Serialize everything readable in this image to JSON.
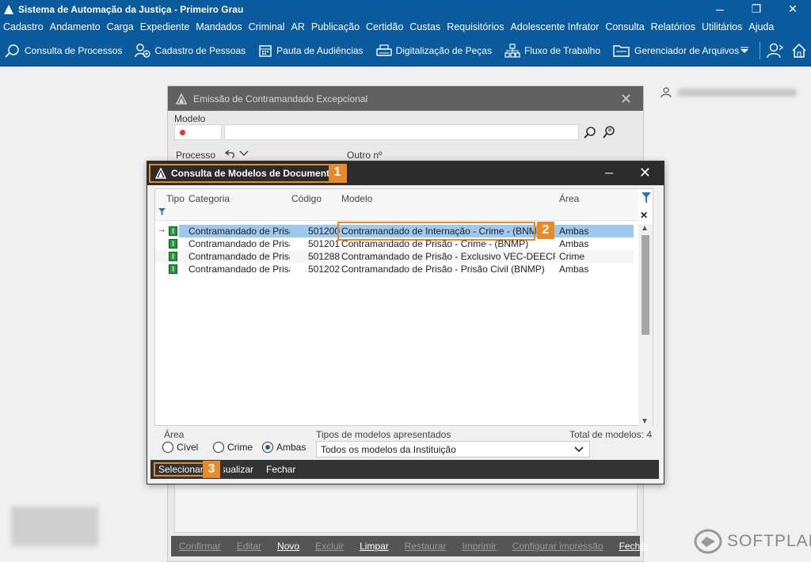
{
  "app": {
    "title": "Sistema de Automação da Justiça - Primeiro Grau"
  },
  "menu": [
    "Cadastro",
    "Andamento",
    "Carga",
    "Expediente",
    "Mandados",
    "Criminal",
    "AR",
    "Publicação",
    "Certidão",
    "Custas",
    "Requisitórios",
    "Adolescente Infrator",
    "Consulta",
    "Relatórios",
    "Utilitários",
    "Ajuda"
  ],
  "toolbar": {
    "items": [
      {
        "label": "Consulta de Processos",
        "icon": "search-folder-icon"
      },
      {
        "label": "Cadastro de Pessoas",
        "icon": "add-person-icon"
      },
      {
        "label": "Pauta de Audiências",
        "icon": "calendar-icon"
      },
      {
        "label": "Digitalização de Peças",
        "icon": "scanner-icon"
      },
      {
        "label": "Fluxo de Trabalho",
        "icon": "workflow-icon"
      },
      {
        "label": "Gerenciador de Arquivos",
        "icon": "file-manager-icon"
      }
    ]
  },
  "back_window": {
    "title": "Emissão de Contramandado Excepcional",
    "modelo_label": "Modelo",
    "processo_label": "Processo",
    "outro_label": "Outro nº",
    "buttons": {
      "confirmar": "Confirmar",
      "editar": "Editar",
      "novo": "Novo",
      "excluir": "Excluir",
      "limpar": "Limpar",
      "restaurar": "Restaurar",
      "imprimir": "Imprimir",
      "configurar": "Configurar impressão",
      "fechar": "Fechar"
    }
  },
  "dialog": {
    "title": "Consulta de Modelos de Documentos",
    "columns": {
      "tipo": "Tipo",
      "categoria": "Categoria",
      "codigo": "Código",
      "modelo": "Modelo",
      "area": "Área"
    },
    "rows": [
      {
        "categoria": "Contramandado de Prisão",
        "codigo": "501200",
        "modelo": "Contramandado de Internação - Crime - (BNMP)",
        "area": "Ambas"
      },
      {
        "categoria": "Contramandado de Prisão",
        "codigo": "501201",
        "modelo": "Contramandado de Prisão - Crime - (BNMP)",
        "area": "Ambas"
      },
      {
        "categoria": "Contramandado de Prisão",
        "codigo": "501288",
        "modelo": "Contramandado de Prisão - Exclusivo VEC-DEECRIM - (BNMP)",
        "area": "Crime"
      },
      {
        "categoria": "Contramandado de Prisão",
        "codigo": "501202",
        "modelo": "Contramandado de Prisão - Prisão Civil (BNMP)",
        "area": "Ambas"
      }
    ],
    "area_label": "Área",
    "radios": {
      "civel": "Cível",
      "crime": "Crime",
      "ambas": "Ambas"
    },
    "tipos_label": "Tipos de modelos apresentados",
    "tipos_value": "Todos os modelos da Instituição",
    "total_label": "Total de modelos: 4",
    "buttons": {
      "selecionar": "Selecionar",
      "visualizar": "Visualizar",
      "fechar": "Fechar"
    }
  },
  "callouts": [
    "1",
    "2",
    "3"
  ],
  "brand": "SOFTPLAN",
  "colors": {
    "accent": "#0a5a9e",
    "callout": "#e8892a",
    "selection": "#9ec8ee"
  }
}
